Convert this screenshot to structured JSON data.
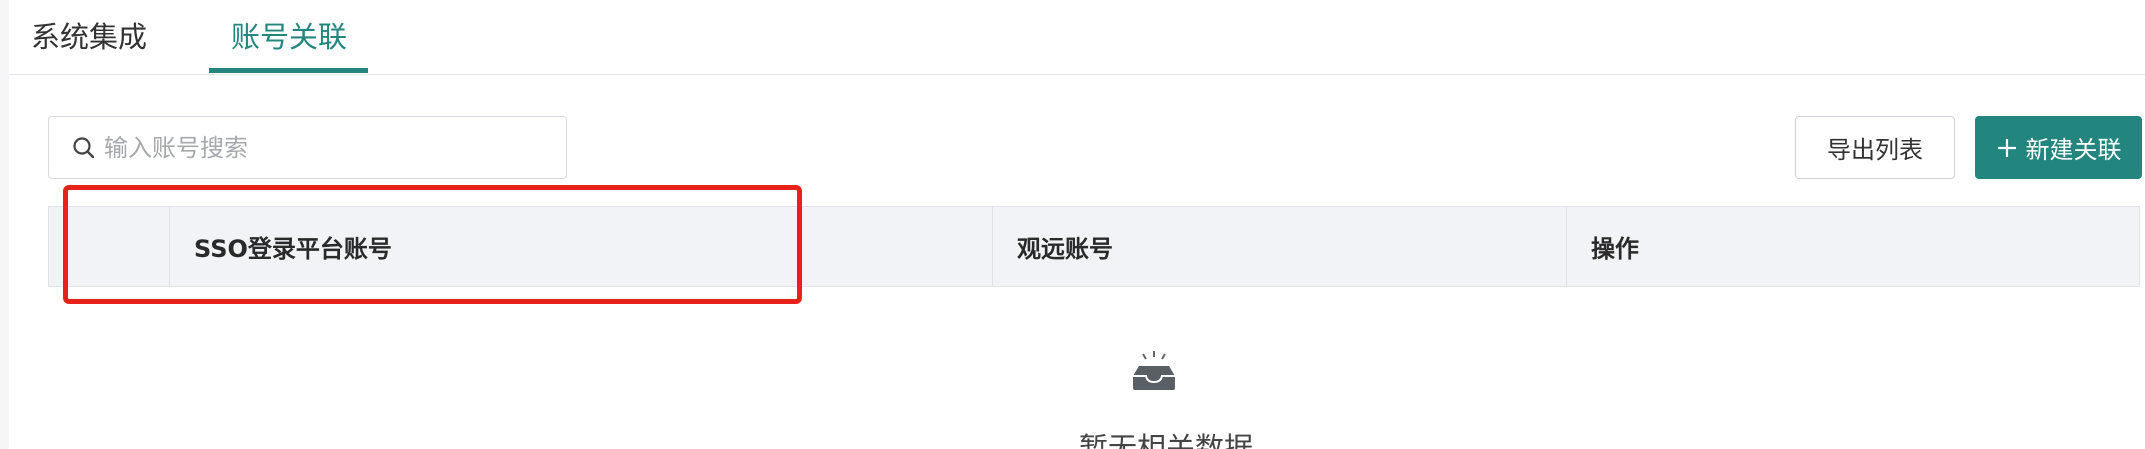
{
  "tabs": [
    {
      "label": "系统集成",
      "active": false
    },
    {
      "label": "账号关联",
      "active": true
    }
  ],
  "search": {
    "placeholder": "输入账号搜索",
    "value": ""
  },
  "toolbar": {
    "export_label": "导出列表",
    "new_label": "新建关联"
  },
  "table": {
    "columns": [
      "SSO登录平台账号",
      "观远账号",
      "操作"
    ],
    "rows": []
  },
  "empty_state": {
    "text": "暂无相关数据",
    "icon": "empty-inbox-icon"
  },
  "colors": {
    "accent": "#22867e",
    "highlight": "#e8211b"
  }
}
